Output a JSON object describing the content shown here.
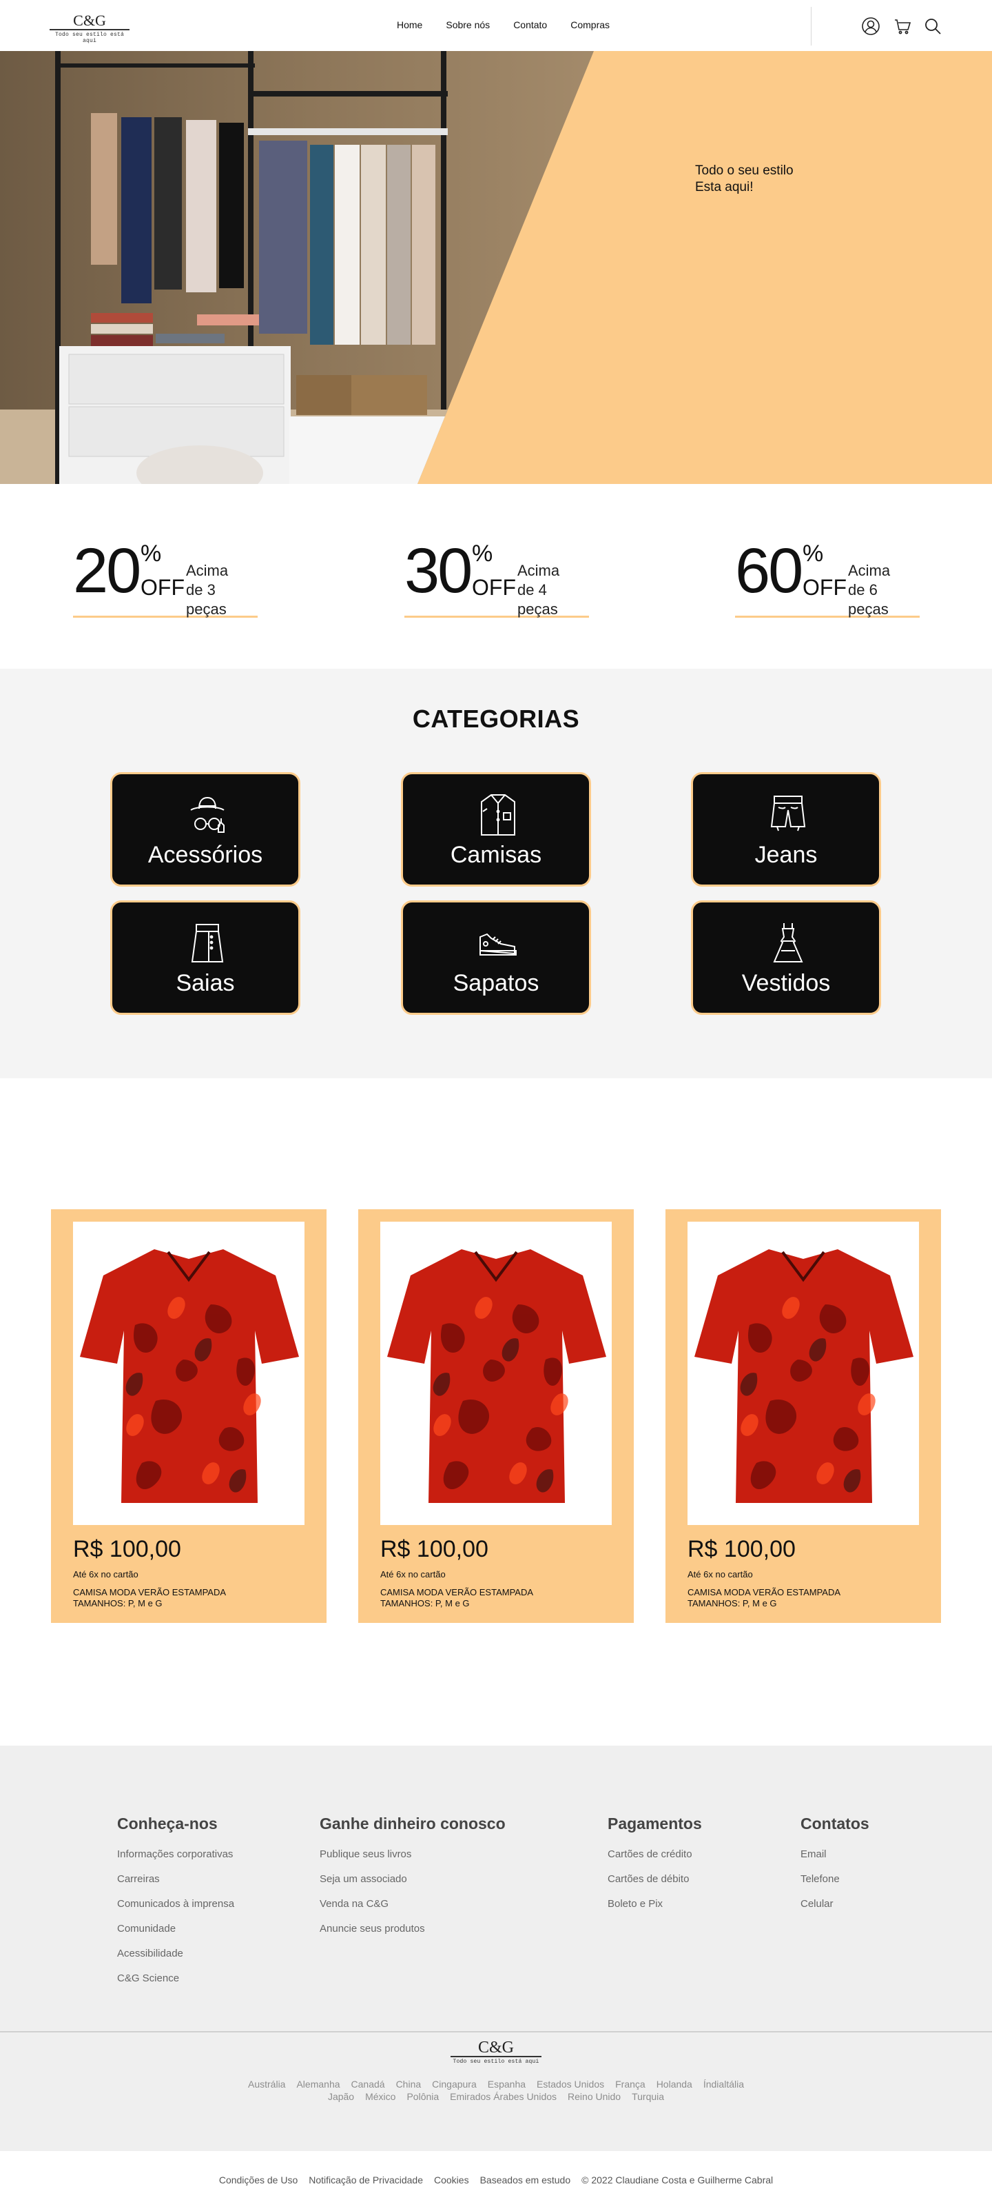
{
  "brand": {
    "name": "C&G",
    "tagline": "Todo seu estilo está aqui"
  },
  "nav": {
    "items": [
      {
        "label": "Home"
      },
      {
        "label": "Sobre nós"
      },
      {
        "label": "Contato"
      },
      {
        "label": "Compras"
      }
    ]
  },
  "header_icons": [
    "user-icon",
    "cart-icon",
    "search-icon"
  ],
  "hero": {
    "line1": "Todo o seu estilo",
    "line2": "Esta aqui!"
  },
  "offers": [
    {
      "number": "20",
      "percent": "%",
      "off": "OFF",
      "line1": "Acima",
      "line2": "de 3 peças"
    },
    {
      "number": "30",
      "percent": "%",
      "off": "OFF",
      "line1": "Acima",
      "line2": "de 4 peças"
    },
    {
      "number": "60",
      "percent": "%",
      "off": "OFF",
      "line1": "Acima",
      "line2": "de 6 peças"
    }
  ],
  "categories": {
    "title": "CATEGORIAS",
    "items": [
      {
        "label": "Acessórios",
        "icon": "hat-glasses-icon"
      },
      {
        "label": "Camisas",
        "icon": "shirt-icon"
      },
      {
        "label": "Jeans",
        "icon": "shorts-icon"
      },
      {
        "label": "Saias",
        "icon": "skirt-icon"
      },
      {
        "label": "Sapatos",
        "icon": "sneaker-icon"
      },
      {
        "label": "Vestidos",
        "icon": "dress-icon"
      }
    ]
  },
  "products": [
    {
      "price": "R$ 100,00",
      "installments": "Até 6x no cartão",
      "name": "CAMISA MODA VERÃO ESTAMPADA",
      "sizes": "TAMANHOS: P, M e G"
    },
    {
      "price": "R$ 100,00",
      "installments": "Até 6x no cartão",
      "name": "CAMISA MODA VERÃO ESTAMPADA",
      "sizes": "TAMANHOS: P, M e G"
    },
    {
      "price": "R$ 100,00",
      "installments": "Até 6x no cartão",
      "name": "CAMISA MODA VERÃO ESTAMPADA",
      "sizes": "TAMANHOS: P, M e G"
    }
  ],
  "footer": {
    "columns": [
      {
        "title": "Conheça-nos",
        "links": [
          "Informações corporativas",
          "Carreiras",
          "Comunicados à imprensa",
          "Comunidade",
          "Acessibilidade",
          "C&G Science"
        ]
      },
      {
        "title": "Ganhe dinheiro conosco",
        "links": [
          "Publique seus livros",
          "Seja um associado",
          "Venda na C&G",
          "Anuncie seus produtos"
        ]
      },
      {
        "title": "Pagamentos",
        "links": [
          "Cartões de crédito",
          "Cartões de débito",
          "Boleto e Pix"
        ]
      },
      {
        "title": "Contatos",
        "links": [
          "Email",
          "Telefone",
          "Celular"
        ]
      }
    ],
    "countries_row1": [
      "Austrália",
      "Alemanha",
      "Canadá",
      "China",
      "Cingapura",
      "Espanha",
      "Estados Unidos",
      "França",
      "Holanda",
      "Índialtália"
    ],
    "countries_row2": [
      "Japão",
      "México",
      "Polônia",
      "Emirados Árabes Unidos",
      "Reino Unido",
      "Turquia"
    ],
    "legal": [
      "Condições de Uso",
      "Notificação de Privacidade",
      "Cookies",
      "Baseados em estudo",
      "© 2022 Claudiane Costa e Guilherme Cabral"
    ]
  },
  "colors": {
    "accent": "#fccb8a",
    "card_dark": "#0d0d0d",
    "footer_bg": "#efefef",
    "categories_bg": "#f4f4f4"
  }
}
